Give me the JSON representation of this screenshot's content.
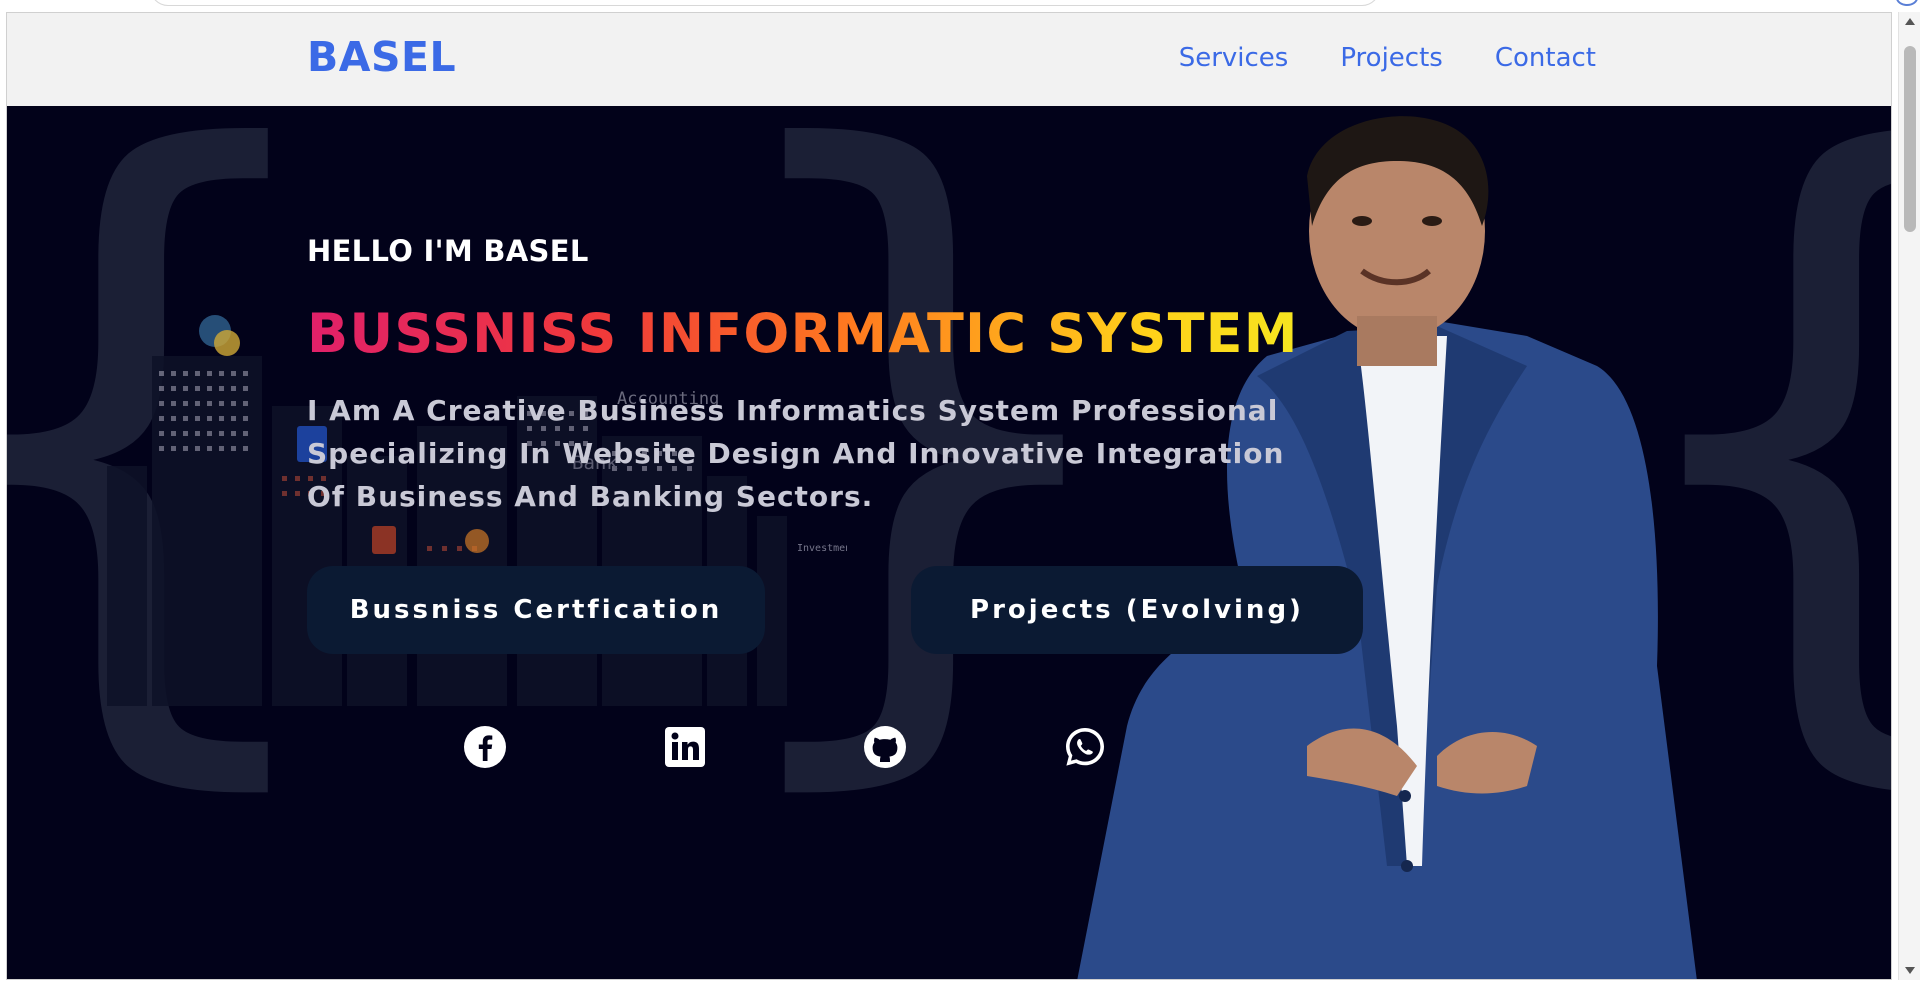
{
  "nav": {
    "brand": "BASEL",
    "links": [
      "Services",
      "Projects",
      "Contact"
    ]
  },
  "hero": {
    "greeting": "HELLO I'M BASEL",
    "headline_typed": "BUSSNISS INFORMATIC SYSTEM",
    "description": "I Am A Creative Business Informatics System Professional Specializing In Website Design And Innovative Integration Of Business And Banking Sectors.",
    "buttons": {
      "certification": "Bussniss Certfication",
      "projects": "Projects (Evolving)"
    },
    "background_labels": {
      "accounting": "Accounting",
      "bank": "Bank",
      "investment": "Investment"
    }
  },
  "social_icons": [
    "facebook-icon",
    "linkedin-icon",
    "github-icon",
    "whatsapp-icon"
  ],
  "colors": {
    "brand": "#3b6ae6",
    "hero_bg": "#02021a",
    "button_bg": "#0b1a33",
    "gradient": [
      "#e0206a",
      "#ff7a1f",
      "#ffd21a"
    ]
  }
}
